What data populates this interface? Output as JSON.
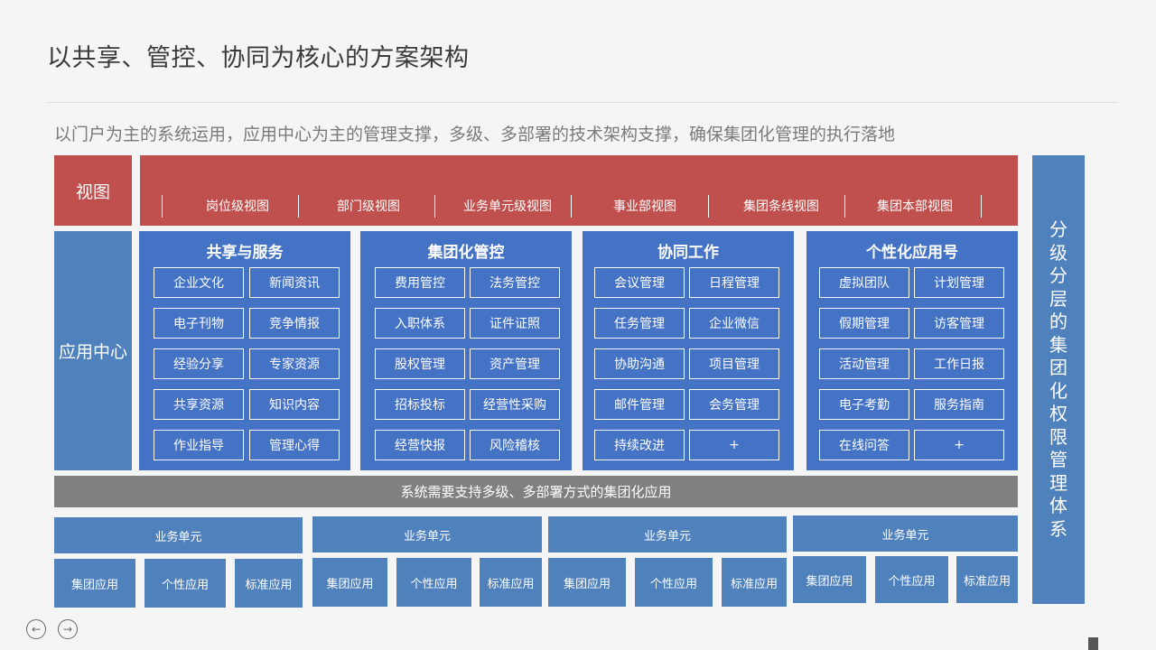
{
  "title": "以共享、管控、协同为核心的方案架构",
  "subtitle": "以门户为主的系统运用，应用中心为主的管理支撑，多级、多部署的技术架构支撑，确保集团化管理的执行落地",
  "view": {
    "label": "视图",
    "tabs": [
      "岗位级视图",
      "部门级视图",
      "业务单元级视图",
      "事业部视图",
      "集团条线视图",
      "集团本部视图"
    ]
  },
  "app_center": {
    "label": "应用中心",
    "panels": [
      {
        "title": "共享与服务",
        "items": [
          "企业文化",
          "新闻资讯",
          "电子刊物",
          "竞争情报",
          "经验分享",
          "专家资源",
          "共享资源",
          "知识内容",
          "作业指导",
          "管理心得"
        ]
      },
      {
        "title": "集团化管控",
        "items": [
          "费用管控",
          "法务管控",
          "入职体系",
          "证件证照",
          "股权管理",
          "资产管理",
          "招标投标",
          "经营性采购",
          "经营快报",
          "风险稽核"
        ]
      },
      {
        "title": "协同工作",
        "items": [
          "会议管理",
          "日程管理",
          "任务管理",
          "企业微信",
          "协助沟通",
          "项目管理",
          "邮件管理",
          "会务管理",
          "持续改进",
          "+"
        ]
      },
      {
        "title": "个性化应用号",
        "items": [
          "虚拟团队",
          "计划管理",
          "假期管理",
          "访客管理",
          "活动管理",
          "工作日报",
          "电子考勤",
          "服务指南",
          "在线问答",
          "+"
        ]
      }
    ]
  },
  "system_bar": "系统需要支持多级、多部署方式的集团化应用",
  "business_units": [
    {
      "label": "业务单元",
      "apps": [
        "集团应用",
        "个性应用",
        "标准应用"
      ]
    },
    {
      "label": "业务单元",
      "apps": [
        "集团应用",
        "个性应用",
        "标准应用"
      ]
    },
    {
      "label": "业务单元",
      "apps": [
        "集团应用",
        "个性应用",
        "标准应用"
      ]
    },
    {
      "label": "业务单元",
      "apps": [
        "集团应用",
        "个性应用",
        "标准应用"
      ]
    }
  ],
  "side_label": "分级分层的集团化权限管理体系",
  "nav": {
    "prev": "←",
    "next": "→"
  },
  "colors": {
    "view": "#c0504d",
    "label": "#4f81bd",
    "panel": "#4472c4",
    "system": "#808080"
  }
}
